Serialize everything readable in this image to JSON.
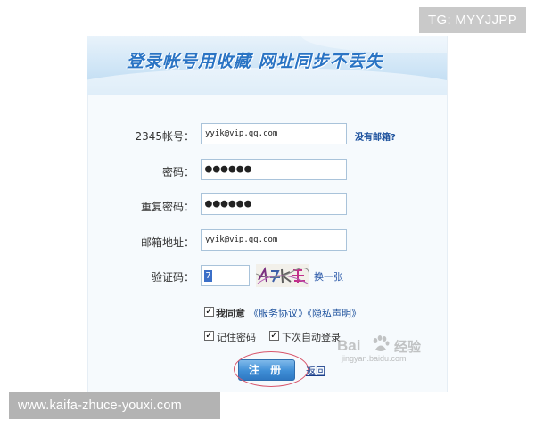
{
  "overlay": {
    "tg_badge": "TG: MYYJJPP",
    "url": "www.kaifa-zhuce-youxi.com"
  },
  "banner": {
    "slogan": "登录帐号用收藏  网址同步不丢失"
  },
  "form": {
    "account": {
      "label": "2345帐号：",
      "value": "yyik@vip.qq.com"
    },
    "no_email_link": "没有邮箱?",
    "password": {
      "label": "密码：",
      "value": "●●●●●●"
    },
    "confirm_password": {
      "label": "重复密码：",
      "value": "●●●●●●"
    },
    "email": {
      "label": "邮箱地址：",
      "value": "yyik@vip.qq.com"
    },
    "captcha": {
      "label": "验证码：",
      "value": "7",
      "change_link": "换一张"
    },
    "agree": {
      "checked": true,
      "label": "我同意",
      "terms_link": "《服务协议》",
      "privacy_link": "《隐私声明》"
    },
    "remember_password": {
      "checked": true,
      "label": "记住密码"
    },
    "auto_login": {
      "checked": true,
      "label": "下次自动登录"
    },
    "submit_label": "注 册",
    "back_link": "返回"
  },
  "watermark": {
    "brand_left": "Bai",
    "brand_right": "经验",
    "sub": "jingyan.baidu.com"
  },
  "colors": {
    "accent": "#2a74c4",
    "link": "#1a4f9c",
    "highlight_circle": "#d8566c"
  }
}
